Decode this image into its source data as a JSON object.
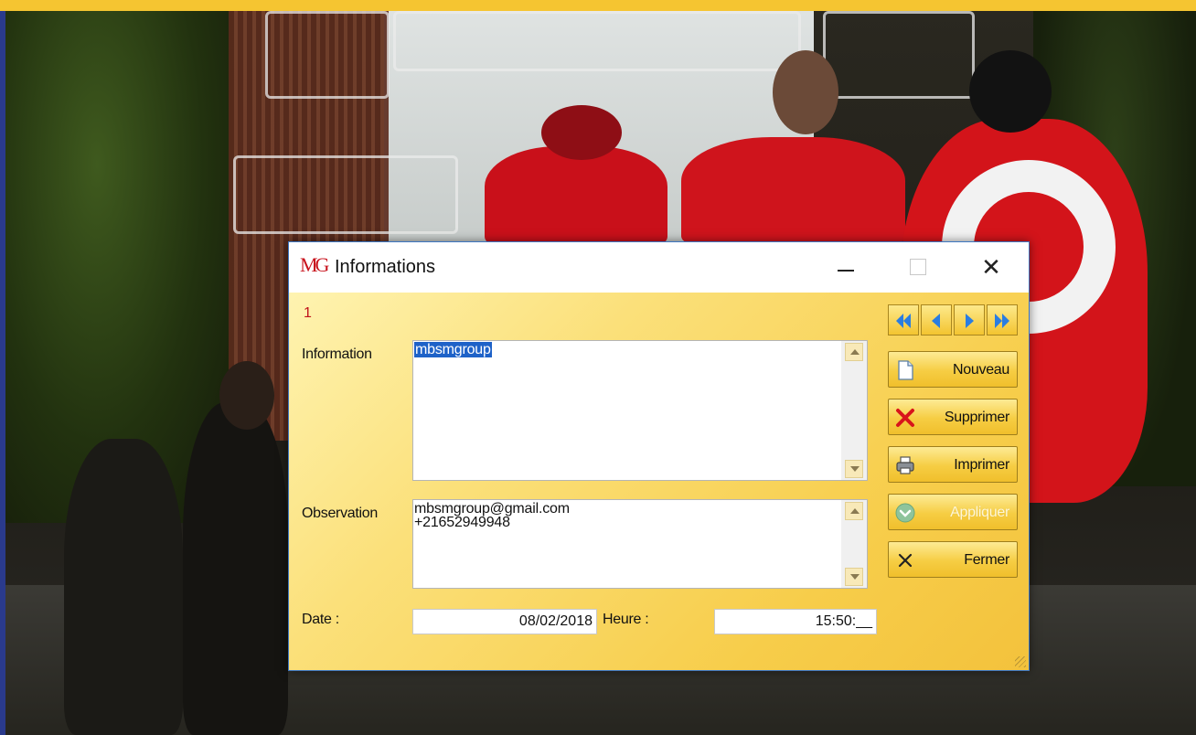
{
  "window": {
    "title": "Informations",
    "icon_glyph": "MG"
  },
  "record": {
    "number": "1"
  },
  "form": {
    "information_label": "Information",
    "information_value": "mbsmgroup",
    "observation_label": "Observation",
    "observation_lines": [
      "mbsmgroup@gmail.com",
      "+21652949948"
    ],
    "date_label": "Date :",
    "date_value": "08/02/2018",
    "time_label": "Heure :",
    "time_value": "15:50:__"
  },
  "buttons": {
    "nouveau": "Nouveau",
    "supprimer": "Supprimer",
    "imprimer": "Imprimer",
    "appliquer": "Appliquer",
    "fermer": "Fermer"
  },
  "navigation": [
    "first-record-icon",
    "previous-record-icon",
    "next-record-icon",
    "last-record-icon"
  ],
  "colors": {
    "accent_red": "#c0121b",
    "dialog_yellow": "#f7cd4a",
    "nav_blue": "#2a7de1",
    "selection_blue": "#1e62c8"
  }
}
